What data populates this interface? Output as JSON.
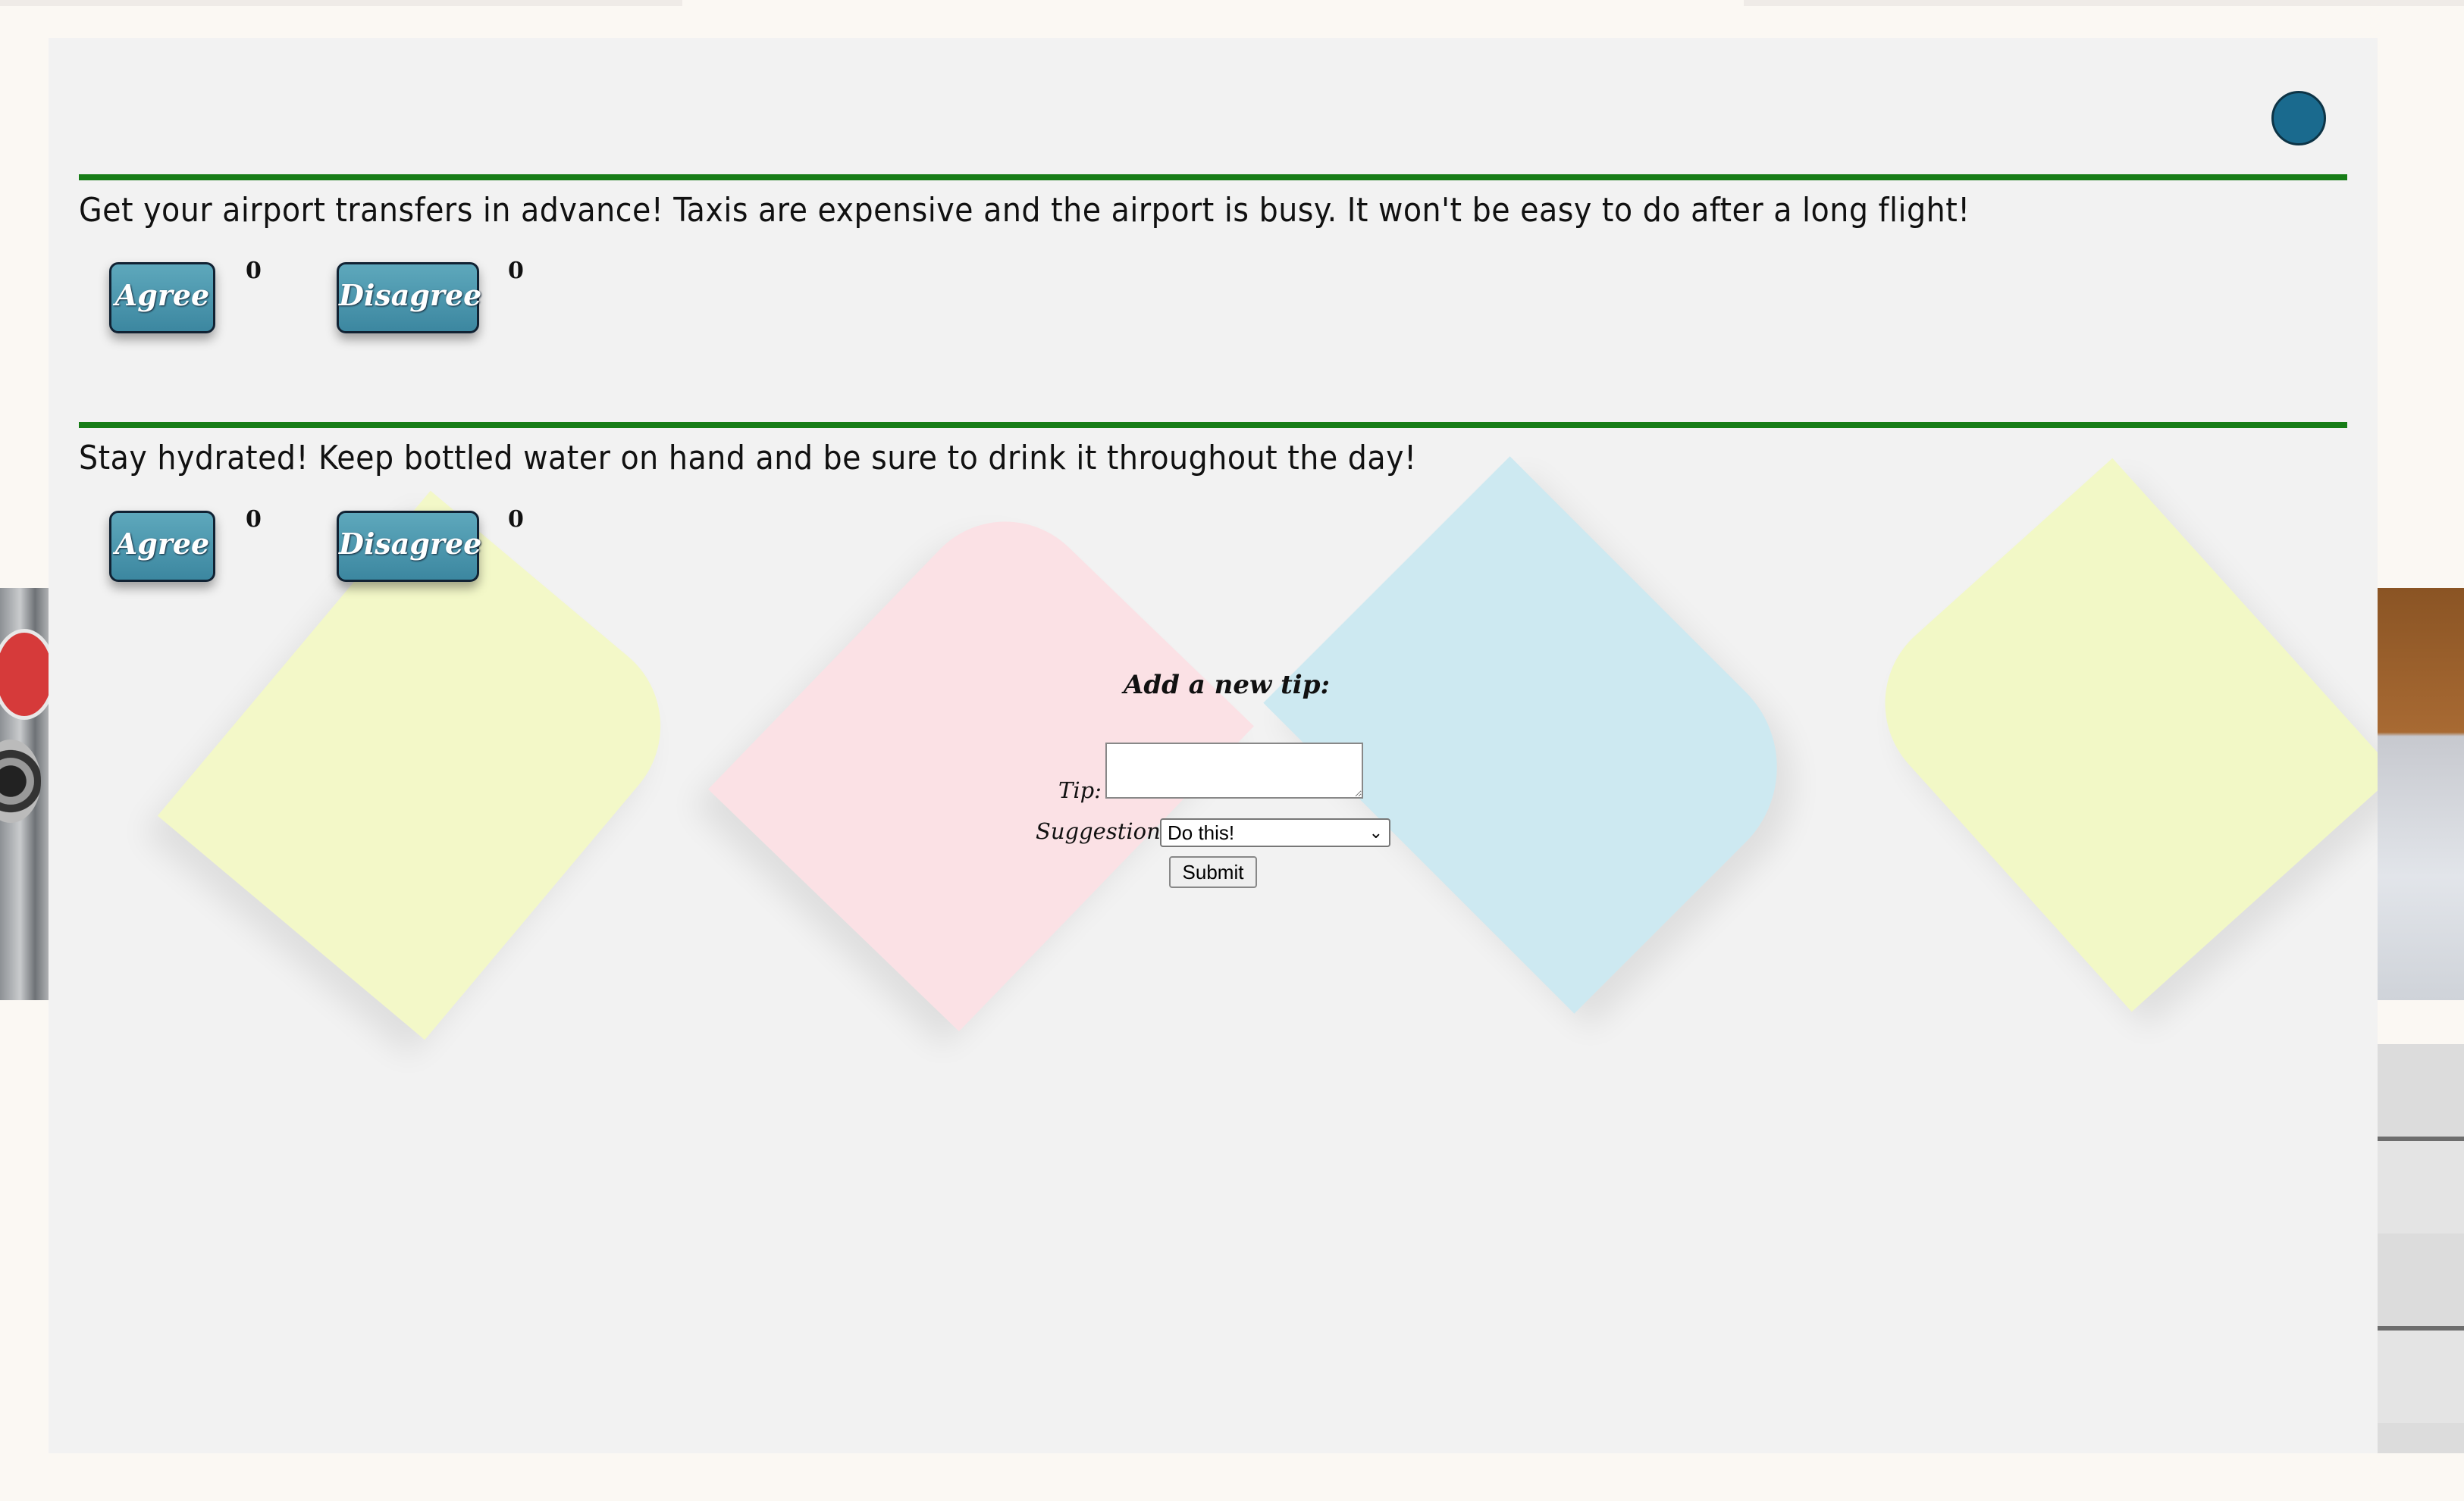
{
  "tips": [
    {
      "text": "Get your airport transfers in advance! Taxis are expensive and the airport is busy. It won't be easy to do after a long flight!",
      "agree_label": "Agree",
      "agree_count": "0",
      "disagree_label": "Disagree",
      "disagree_count": "0"
    },
    {
      "text": "Stay hydrated! Keep bottled water on hand and be sure to drink it throughout the day!",
      "agree_label": "Agree",
      "agree_count": "0",
      "disagree_label": "Disagree",
      "disagree_count": "0"
    }
  ],
  "form": {
    "title": "Add a new tip:",
    "tip_label": "Tip:",
    "tip_value": "",
    "suggestion_label": "Suggestion:",
    "suggestion_value": "Do this!",
    "submit_label": "Submit"
  },
  "colors": {
    "divider": "#177d17",
    "button": "#3c87a0",
    "avatar": "#1a6a8e"
  }
}
